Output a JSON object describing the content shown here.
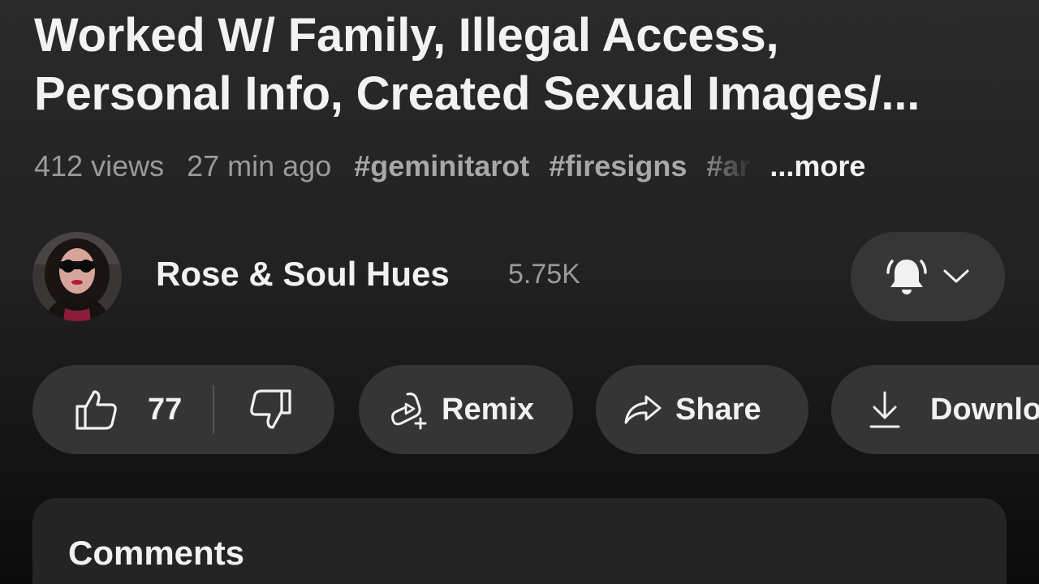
{
  "video": {
    "title_line1": "Worked W/ Family, Illegal Access,",
    "title_line2": "Personal Info, Created Sexual Images/...",
    "views": "412 views",
    "age": "27 min ago",
    "hashtags": [
      "#geminitarot",
      "#firesigns",
      "#ar"
    ],
    "more_label": "...more"
  },
  "channel": {
    "name": "Rose & Soul Hues",
    "subscribers": "5.75K",
    "avatar_icon": "person-avatar",
    "bell_icon": "bell-icon"
  },
  "actions": {
    "like_count": "77",
    "remix_label": "Remix",
    "share_label": "Share",
    "download_label": "Download"
  },
  "comments": {
    "title": "Comments"
  }
}
